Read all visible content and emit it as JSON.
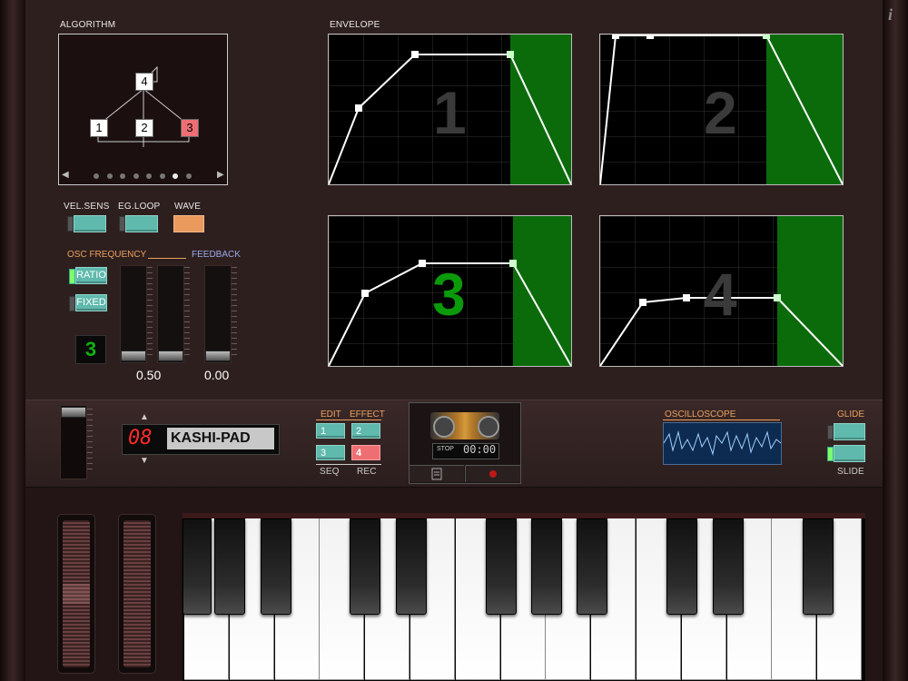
{
  "algorithm": {
    "label": "ALGORITHM",
    "nodes": [
      "4",
      "1",
      "2",
      "3"
    ],
    "active_node": "3",
    "nav_left": "◀",
    "nav_right": "▶",
    "page_dots": 8,
    "active_dot": 6
  },
  "envelope": {
    "label": "ENVELOPE",
    "panels": [
      {
        "number": "1"
      },
      {
        "number": "2"
      },
      {
        "number": "3",
        "active": true
      },
      {
        "number": "4"
      }
    ]
  },
  "operator": {
    "vel_sens_label": "VEL.SENS",
    "eg_loop_label": "EG.LOOP",
    "wave_label": "WAVE",
    "osc_frequency_label": "OSC FREQUENCY",
    "feedback_label": "FEEDBACK",
    "ratio_label": "RATIO",
    "fixed_label": "FIXED",
    "operator_number": "3",
    "osc_value": "0.50",
    "feedback_value": "0.00"
  },
  "program": {
    "up_arrow": "▲",
    "down_arrow": "▼",
    "number": "08",
    "name": "KASHI-PAD"
  },
  "modes": {
    "edit_label": "EDIT",
    "effect_label": "EFFECT",
    "seq_label": "SEQ",
    "rec_label": "REC",
    "btn1": "1",
    "btn2": "2",
    "btn3": "3",
    "btn4": "4"
  },
  "recorder": {
    "stop_label": "STOP",
    "time": "00:00"
  },
  "oscilloscope": {
    "label": "OSCILLOSCOPE"
  },
  "glide": {
    "glide_label": "GLIDE",
    "slide_label": "SLIDE"
  },
  "info_icon_glyph": "i",
  "colors": {
    "teal": "#5fb9ad",
    "orange": "#eb9a5e",
    "red": "#ee6f73",
    "green_release": "#0b6b0b"
  }
}
